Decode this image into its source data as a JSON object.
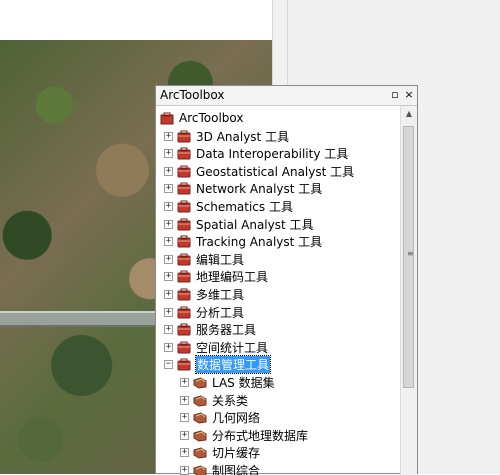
{
  "window": {
    "title": "ArcToolbox",
    "btn_pin": "▫",
    "btn_close": "×"
  },
  "tree": {
    "root": "ArcToolbox",
    "items": [
      {
        "label": "3D Analyst 工具",
        "expander": "+"
      },
      {
        "label": "Data Interoperability 工具",
        "expander": "+"
      },
      {
        "label": "Geostatistical Analyst 工具",
        "expander": "+"
      },
      {
        "label": "Network Analyst 工具",
        "expander": "+"
      },
      {
        "label": "Schematics 工具",
        "expander": "+"
      },
      {
        "label": "Spatial Analyst 工具",
        "expander": "+"
      },
      {
        "label": "Tracking Analyst 工具",
        "expander": "+"
      },
      {
        "label": "编辑工具",
        "expander": "+"
      },
      {
        "label": "地理编码工具",
        "expander": "+"
      },
      {
        "label": "多维工具",
        "expander": "+"
      },
      {
        "label": "分析工具",
        "expander": "+"
      },
      {
        "label": "服务器工具",
        "expander": "+"
      },
      {
        "label": "空间统计工具",
        "expander": "+"
      },
      {
        "label": "数据管理工具",
        "expander": "−",
        "selected": true
      }
    ],
    "subitems": [
      {
        "label": "LAS 数据集",
        "expander": "+"
      },
      {
        "label": "关系类",
        "expander": "+"
      },
      {
        "label": "几何网络",
        "expander": "+"
      },
      {
        "label": "分布式地理数据库",
        "expander": "+"
      },
      {
        "label": "切片缓存",
        "expander": "+"
      },
      {
        "label": "制图综合",
        "expander": "+"
      }
    ]
  },
  "scrollbar": {
    "up": "▲",
    "grip": "≡"
  },
  "colors": {
    "selection": "#3399ff",
    "toolbox_icon": "#c0392b"
  }
}
